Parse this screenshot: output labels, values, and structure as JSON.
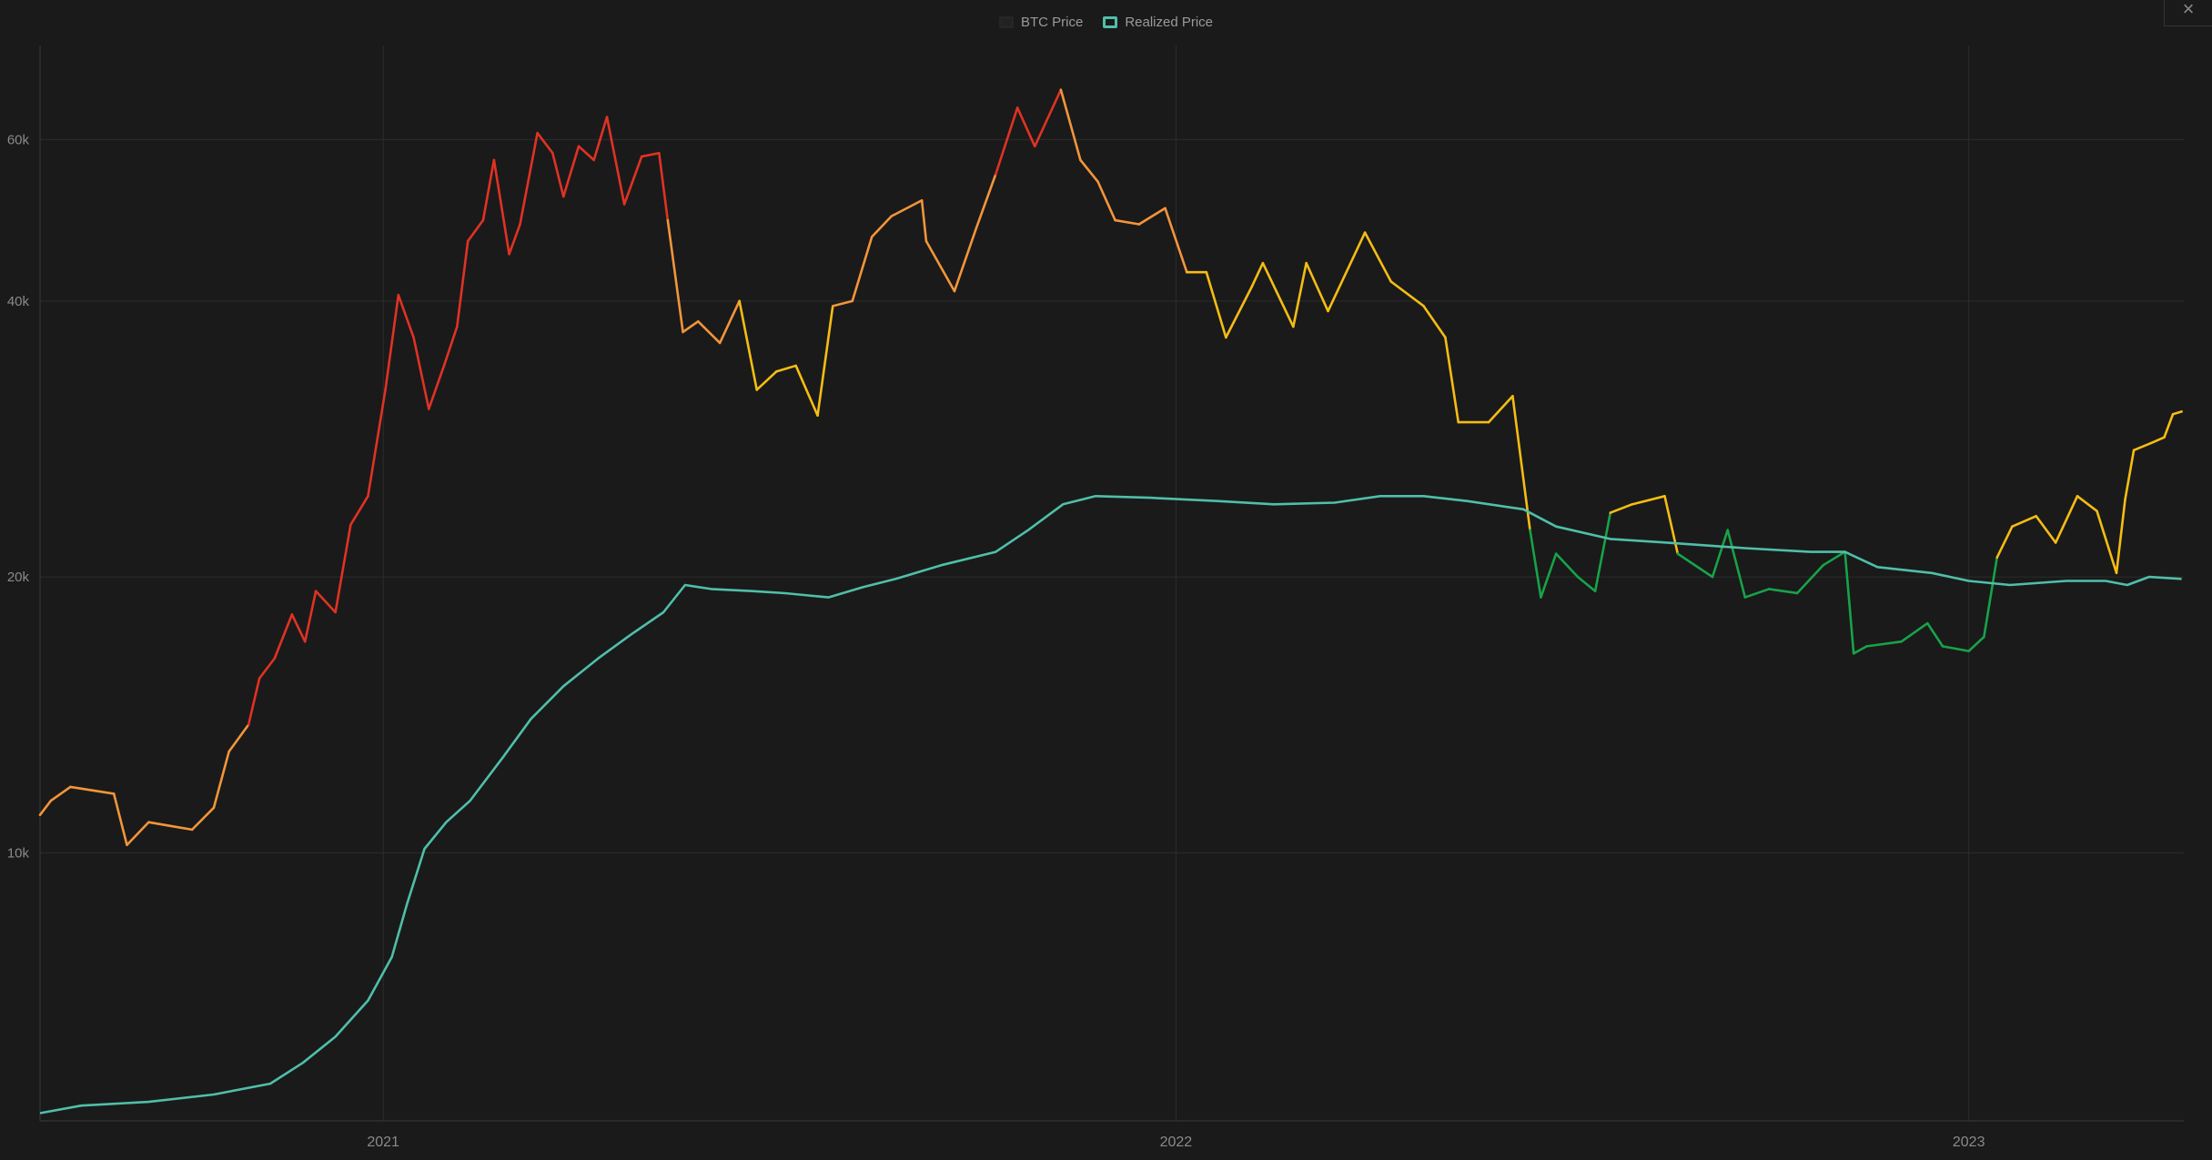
{
  "legend": {
    "btc_label": "BTC Price",
    "realized_label": "Realized Price"
  },
  "close_glyph": "×",
  "colors": {
    "background": "#1a1a1a",
    "grid": "#2c2c2c",
    "realized": "#4fbfa9",
    "band_red": "#e03224",
    "band_orange": "#f3953a",
    "band_yellow": "#f5bd13",
    "band_green": "#18a249",
    "tick_text": "#8a8a8a"
  },
  "chart_data": {
    "type": "line",
    "title": "",
    "xlabel": "",
    "ylabel": "",
    "y_scale": "log",
    "ylim": [
      5100,
      76000
    ],
    "xlim": [
      "2020-07-27",
      "2023-04-10"
    ],
    "grid": true,
    "legend_position": "top-center",
    "y_ticks": [
      {
        "value": 10000,
        "label": "10k"
      },
      {
        "value": 20000,
        "label": "20k"
      },
      {
        "value": 40000,
        "label": "40k"
      },
      {
        "value": 60000,
        "label": "60k"
      }
    ],
    "x_ticks": [
      {
        "value": "2021-01-01",
        "label": "2021"
      },
      {
        "value": "2022-01-01",
        "label": "2022"
      },
      {
        "value": "2023-01-01",
        "label": "2023"
      }
    ],
    "series": [
      {
        "name": "BTC Price",
        "color_rule": "colored by price-to-realized-price ratio",
        "points": [
          [
            "2020-07-27",
            11000
          ],
          [
            "2020-08-01",
            11400
          ],
          [
            "2020-08-10",
            11800
          ],
          [
            "2020-08-20",
            11700
          ],
          [
            "2020-08-30",
            11600
          ],
          [
            "2020-09-05",
            10200
          ],
          [
            "2020-09-15",
            10800
          ],
          [
            "2020-09-25",
            10700
          ],
          [
            "2020-10-05",
            10600
          ],
          [
            "2020-10-15",
            11200
          ],
          [
            "2020-10-22",
            12900
          ],
          [
            "2020-10-31",
            13800
          ],
          [
            "2020-11-05",
            15500
          ],
          [
            "2020-11-12",
            16300
          ],
          [
            "2020-11-20",
            18200
          ],
          [
            "2020-11-26",
            17000
          ],
          [
            "2020-12-01",
            19300
          ],
          [
            "2020-12-10",
            18300
          ],
          [
            "2020-12-17",
            22800
          ],
          [
            "2020-12-25",
            24500
          ],
          [
            "2021-01-02",
            32000
          ],
          [
            "2021-01-08",
            40600
          ],
          [
            "2021-01-15",
            36500
          ],
          [
            "2021-01-22",
            30500
          ],
          [
            "2021-01-29",
            34000
          ],
          [
            "2021-02-04",
            37500
          ],
          [
            "2021-02-09",
            46500
          ],
          [
            "2021-02-16",
            49000
          ],
          [
            "2021-02-21",
            57000
          ],
          [
            "2021-02-28",
            45000
          ],
          [
            "2021-03-05",
            48500
          ],
          [
            "2021-03-13",
            61000
          ],
          [
            "2021-03-20",
            58000
          ],
          [
            "2021-03-25",
            52000
          ],
          [
            "2021-04-01",
            59000
          ],
          [
            "2021-04-08",
            57000
          ],
          [
            "2021-04-14",
            63500
          ],
          [
            "2021-04-22",
            51000
          ],
          [
            "2021-04-30",
            57500
          ],
          [
            "2021-05-08",
            58000
          ],
          [
            "2021-05-12",
            49000
          ],
          [
            "2021-05-19",
            37000
          ],
          [
            "2021-05-26",
            38000
          ],
          [
            "2021-06-05",
            36000
          ],
          [
            "2021-06-14",
            40000
          ],
          [
            "2021-06-22",
            32000
          ],
          [
            "2021-07-01",
            33500
          ],
          [
            "2021-07-10",
            34000
          ],
          [
            "2021-07-20",
            30000
          ],
          [
            "2021-07-27",
            39500
          ],
          [
            "2021-08-05",
            40000
          ],
          [
            "2021-08-14",
            47000
          ],
          [
            "2021-08-23",
            49500
          ],
          [
            "2021-09-06",
            51500
          ],
          [
            "2021-09-08",
            46500
          ],
          [
            "2021-09-21",
            41000
          ],
          [
            "2021-10-01",
            48000
          ],
          [
            "2021-10-10",
            55000
          ],
          [
            "2021-10-20",
            65000
          ],
          [
            "2021-10-28",
            59000
          ],
          [
            "2021-11-09",
            68000
          ],
          [
            "2021-11-18",
            57000
          ],
          [
            "2021-11-26",
            54000
          ],
          [
            "2021-12-04",
            49000
          ],
          [
            "2021-12-15",
            48500
          ],
          [
            "2021-12-27",
            50500
          ],
          [
            "2022-01-06",
            43000
          ],
          [
            "2022-01-15",
            43000
          ],
          [
            "2022-01-24",
            36500
          ],
          [
            "2022-02-05",
            41500
          ],
          [
            "2022-02-10",
            44000
          ],
          [
            "2022-02-24",
            37500
          ],
          [
            "2022-03-02",
            44000
          ],
          [
            "2022-03-12",
            39000
          ],
          [
            "2022-03-29",
            47500
          ],
          [
            "2022-04-10",
            42000
          ],
          [
            "2022-04-25",
            39500
          ],
          [
            "2022-05-05",
            36500
          ],
          [
            "2022-05-11",
            29500
          ],
          [
            "2022-05-25",
            29500
          ],
          [
            "2022-06-05",
            31500
          ],
          [
            "2022-06-13",
            22500
          ],
          [
            "2022-06-18",
            19000
          ],
          [
            "2022-06-25",
            21200
          ],
          [
            "2022-07-05",
            20000
          ],
          [
            "2022-07-13",
            19300
          ],
          [
            "2022-07-20",
            23500
          ],
          [
            "2022-07-30",
            24000
          ],
          [
            "2022-08-14",
            24500
          ],
          [
            "2022-08-20",
            21200
          ],
          [
            "2022-09-05",
            20000
          ],
          [
            "2022-09-12",
            22500
          ],
          [
            "2022-09-20",
            19000
          ],
          [
            "2022-10-01",
            19400
          ],
          [
            "2022-10-14",
            19200
          ],
          [
            "2022-10-26",
            20600
          ],
          [
            "2022-11-05",
            21300
          ],
          [
            "2022-11-09",
            16500
          ],
          [
            "2022-11-15",
            16800
          ],
          [
            "2022-12-01",
            17000
          ],
          [
            "2022-12-13",
            17800
          ],
          [
            "2022-12-20",
            16800
          ],
          [
            "2023-01-01",
            16600
          ],
          [
            "2023-01-08",
            17200
          ],
          [
            "2023-01-14",
            21000
          ],
          [
            "2023-01-21",
            22700
          ],
          [
            "2023-02-01",
            23300
          ],
          [
            "2023-02-10",
            21800
          ],
          [
            "2023-02-20",
            24500
          ],
          [
            "2023-03-01",
            23600
          ],
          [
            "2023-03-10",
            20200
          ],
          [
            "2023-03-14",
            24300
          ],
          [
            "2023-03-18",
            27500
          ],
          [
            "2023-03-26",
            28000
          ],
          [
            "2023-04-01",
            28400
          ],
          [
            "2023-04-05",
            30100
          ],
          [
            "2023-04-09",
            30300
          ]
        ]
      },
      {
        "name": "Realized Price",
        "color": "#4fbfa9",
        "points": [
          [
            "2020-07-27",
            5200
          ],
          [
            "2020-08-15",
            5300
          ],
          [
            "2020-09-15",
            5350
          ],
          [
            "2020-10-15",
            5450
          ],
          [
            "2020-11-10",
            5600
          ],
          [
            "2020-11-25",
            5900
          ],
          [
            "2020-12-10",
            6300
          ],
          [
            "2020-12-25",
            6900
          ],
          [
            "2021-01-05",
            7700
          ],
          [
            "2021-01-12",
            8800
          ],
          [
            "2021-01-20",
            10100
          ],
          [
            "2021-01-30",
            10800
          ],
          [
            "2021-02-10",
            11400
          ],
          [
            "2021-02-25",
            12700
          ],
          [
            "2021-03-10",
            14000
          ],
          [
            "2021-03-25",
            15200
          ],
          [
            "2021-04-10",
            16300
          ],
          [
            "2021-04-25",
            17300
          ],
          [
            "2021-05-10",
            18300
          ],
          [
            "2021-05-20",
            19600
          ],
          [
            "2021-06-01",
            19400
          ],
          [
            "2021-06-20",
            19300
          ],
          [
            "2021-07-05",
            19200
          ],
          [
            "2021-07-25",
            19000
          ],
          [
            "2021-08-10",
            19500
          ],
          [
            "2021-08-25",
            19900
          ],
          [
            "2021-09-15",
            20600
          ],
          [
            "2021-10-10",
            21300
          ],
          [
            "2021-10-25",
            22500
          ],
          [
            "2021-11-10",
            24000
          ],
          [
            "2021-11-25",
            24500
          ],
          [
            "2021-12-20",
            24400
          ],
          [
            "2022-01-20",
            24200
          ],
          [
            "2022-02-15",
            24000
          ],
          [
            "2022-03-15",
            24100
          ],
          [
            "2022-04-05",
            24500
          ],
          [
            "2022-04-25",
            24500
          ],
          [
            "2022-05-15",
            24200
          ],
          [
            "2022-06-10",
            23700
          ],
          [
            "2022-06-25",
            22700
          ],
          [
            "2022-07-20",
            22000
          ],
          [
            "2022-08-15",
            21800
          ],
          [
            "2022-09-20",
            21500
          ],
          [
            "2022-10-20",
            21300
          ],
          [
            "2022-11-05",
            21300
          ],
          [
            "2022-11-20",
            20500
          ],
          [
            "2022-12-15",
            20200
          ],
          [
            "2023-01-01",
            19800
          ],
          [
            "2023-01-20",
            19600
          ],
          [
            "2023-02-15",
            19800
          ],
          [
            "2023-03-05",
            19800
          ],
          [
            "2023-03-15",
            19600
          ],
          [
            "2023-03-25",
            20000
          ],
          [
            "2023-04-09",
            19900
          ]
        ]
      }
    ]
  }
}
